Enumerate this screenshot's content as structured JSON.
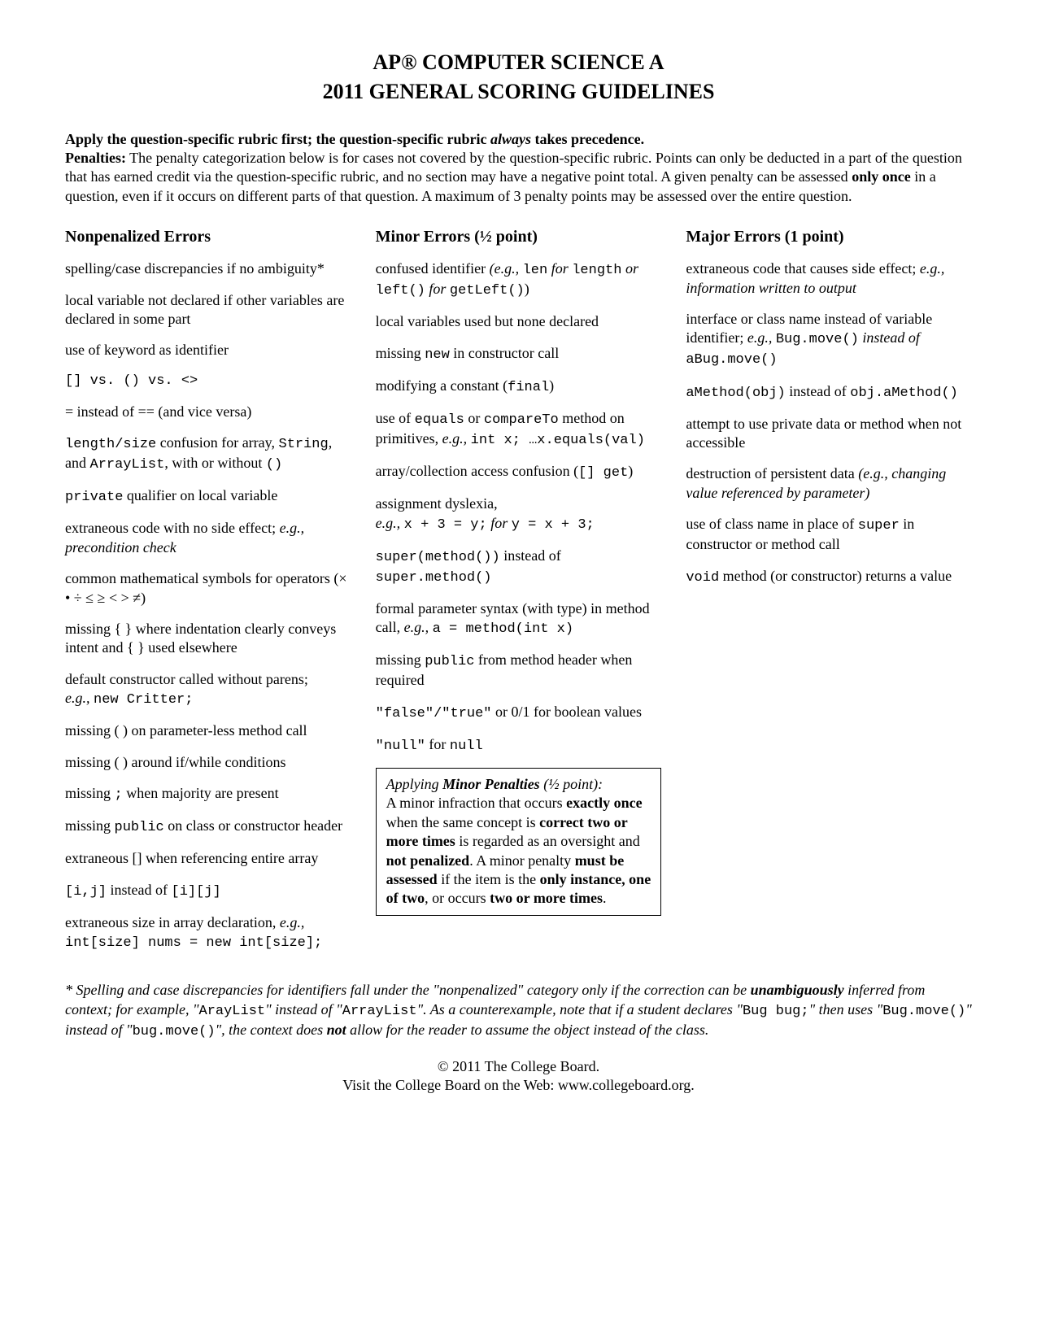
{
  "title1": "AP® COMPUTER SCIENCE A",
  "title2": "2011 GENERAL SCORING GUIDELINES",
  "intro_line1_bold": "Apply the question-specific rubric first; the question-specific rubric ",
  "intro_line1_ital": "always",
  "intro_line1_end": " takes precedence.",
  "intro_penalties_label": "Penalties:",
  "intro_penalties_text": " The penalty categorization below is for cases not covered by the question-specific rubric. Points can only be deducted in a part of the question that has earned credit via the question-specific rubric, and no section may have a negative point total. A given penalty can be assessed ",
  "intro_penalties_bold2": "only once",
  "intro_penalties_text2": " in a question, even if it occurs on different parts of that question. A maximum of 3 penalty points may be assessed over the entire question.",
  "col1_header": "Nonpenalized Errors",
  "col2_header": "Minor Errors (½ point)",
  "col3_header": "Major Errors (1 point)",
  "np1": "spelling/case discrepancies if no ambiguity*",
  "np2": "local variable not declared if other variables are declared in some part",
  "np3": "use of keyword as identifier",
  "np4": "[] vs. () vs. <>",
  "np5": "= instead of == (and vice versa)",
  "np6a": "length/size",
  "np6b": " confusion for array, ",
  "np6c": "String",
  "np6d": ", and ",
  "np6e": "ArrayList",
  "np6f": ", with or without ",
  "np6g": "()",
  "np7a": "private",
  "np7b": " qualifier on local variable",
  "np8a": "extraneous code with no side effect; ",
  "np8b": "e.g., precondition check",
  "np9": "common mathematical symbols for operators (× • ÷ ≤ ≥ < > ≠)",
  "np10": "missing { } where indentation clearly conveys intent and { } used elsewhere",
  "np11a": "default constructor called without parens;",
  "np11b": "e.g., ",
  "np11c": "new Critter;",
  "np12": "missing ( ) on parameter-less method call",
  "np13": "missing ( ) around if/while conditions",
  "np14a": "missing ",
  "np14b": ";",
  "np14c": " when majority are present",
  "np15a": "missing ",
  "np15b": "public",
  "np15c": " on class or constructor header",
  "np16": "extraneous [] when referencing entire array",
  "np17a": "[i,j]",
  "np17b": " instead of ",
  "np17c": "[i][j]",
  "np18a": "extraneous size in array declaration, ",
  "np18b": "e.g., ",
  "np18c": "int[size] nums = new int[size];",
  "mi1a": "confused identifier ",
  "mi1b": "(e.g., ",
  "mi1c": "len",
  "mi1d": " for ",
  "mi1e": "length",
  "mi1f": " or ",
  "mi1g": "left()",
  "mi1h": " for ",
  "mi1i": "getLeft()",
  "mi1j": ")",
  "mi2": "local variables used but none declared",
  "mi3a": "missing ",
  "mi3b": "new",
  "mi3c": " in constructor call",
  "mi4a": "modifying a constant (",
  "mi4b": "final",
  "mi4c": ")",
  "mi5a": "use of ",
  "mi5b": "equals",
  "mi5c": " or ",
  "mi5d": "compareTo",
  "mi5e": " method on primitives, ",
  "mi5f": "e.g., ",
  "mi5g": "int x; …x.equals(val)",
  "mi6a": "array/collection access confusion (",
  "mi6b": "[] get",
  "mi6c": ")",
  "mi7a": "assignment dyslexia,",
  "mi7b": "e.g., ",
  "mi7c": "x + 3 = y;",
  "mi7d": " for ",
  "mi7e": "y = x + 3;",
  "mi8a": "super(method())",
  "mi8b": " instead of ",
  "mi8c": "super.method()",
  "mi9a": "formal parameter syntax (with type) in method call, ",
  "mi9b": "e.g., ",
  "mi9c": "a = method(int x)",
  "mi10a": "missing ",
  "mi10b": "public",
  "mi10c": " from method header when required",
  "mi11a": "\"false\"/\"true\"",
  "mi11b": " or 0/1 for boolean values",
  "mi12a": "\"null\"",
  "mi12b": " for ",
  "mi12c": "null",
  "box_title_a": "Applying ",
  "box_title_b": "Minor Penalties",
  "box_title_c": " (½ point):",
  "box_body1": "A minor infraction that occurs ",
  "box_bold1": "exactly once",
  "box_body2": " when the same concept is ",
  "box_bold2": "correct two or more times",
  "box_body3": " is regarded as an oversight and ",
  "box_bold3": "not penalized",
  "box_body4": ". A minor penalty ",
  "box_bold4": "must be assessed",
  "box_body5": " if the item is the ",
  "box_bold5": "only instance, one of two",
  "box_body6": ", or occurs ",
  "box_bold6": "two or more times",
  "box_body7": ".",
  "ma1a": "extraneous code that causes side effect; ",
  "ma1b": "e.g., information written to output",
  "ma2a": "interface or class name instead of variable identifier; ",
  "ma2b": "e.g., ",
  "ma2c": "Bug.move()",
  "ma2d": " instead of ",
  "ma2e": "aBug.move()",
  "ma3a": "aMethod(obj)",
  "ma3b": " instead of ",
  "ma3c": "obj.aMethod()",
  "ma4": "attempt to use private data or method when not accessible",
  "ma5a": "destruction of persistent data ",
  "ma5b": "(e.g., changing value referenced by parameter)",
  "ma6a": "use of class name in place of ",
  "ma6b": "super",
  "ma6c": " in constructor or method call",
  "ma7a": "void",
  "ma7b": " method (or constructor) returns a value",
  "fn_a": "* Spelling and case discrepancies for identifiers fall under the \"nonpenalized\" category only if the correction can be ",
  "fn_b": "unambiguously",
  "fn_c": " inferred from context; for example, \"",
  "fn_d": "ArayList",
  "fn_e": "\" instead of \"",
  "fn_f": "ArrayList",
  "fn_g": "\". As a counterexample, note that if a student declares \"",
  "fn_h": "Bug bug;",
  "fn_i": "\" then uses \"",
  "fn_j": "Bug.move()",
  "fn_k": "\" instead of \"",
  "fn_l": "bug.move()",
  "fn_m": "\", the context does ",
  "fn_n": "not",
  "fn_o": " allow for the reader to assume the object instead of the class.",
  "footer1": "© 2011 The College Board.",
  "footer2": "Visit the College Board on the Web: www.collegeboard.org."
}
